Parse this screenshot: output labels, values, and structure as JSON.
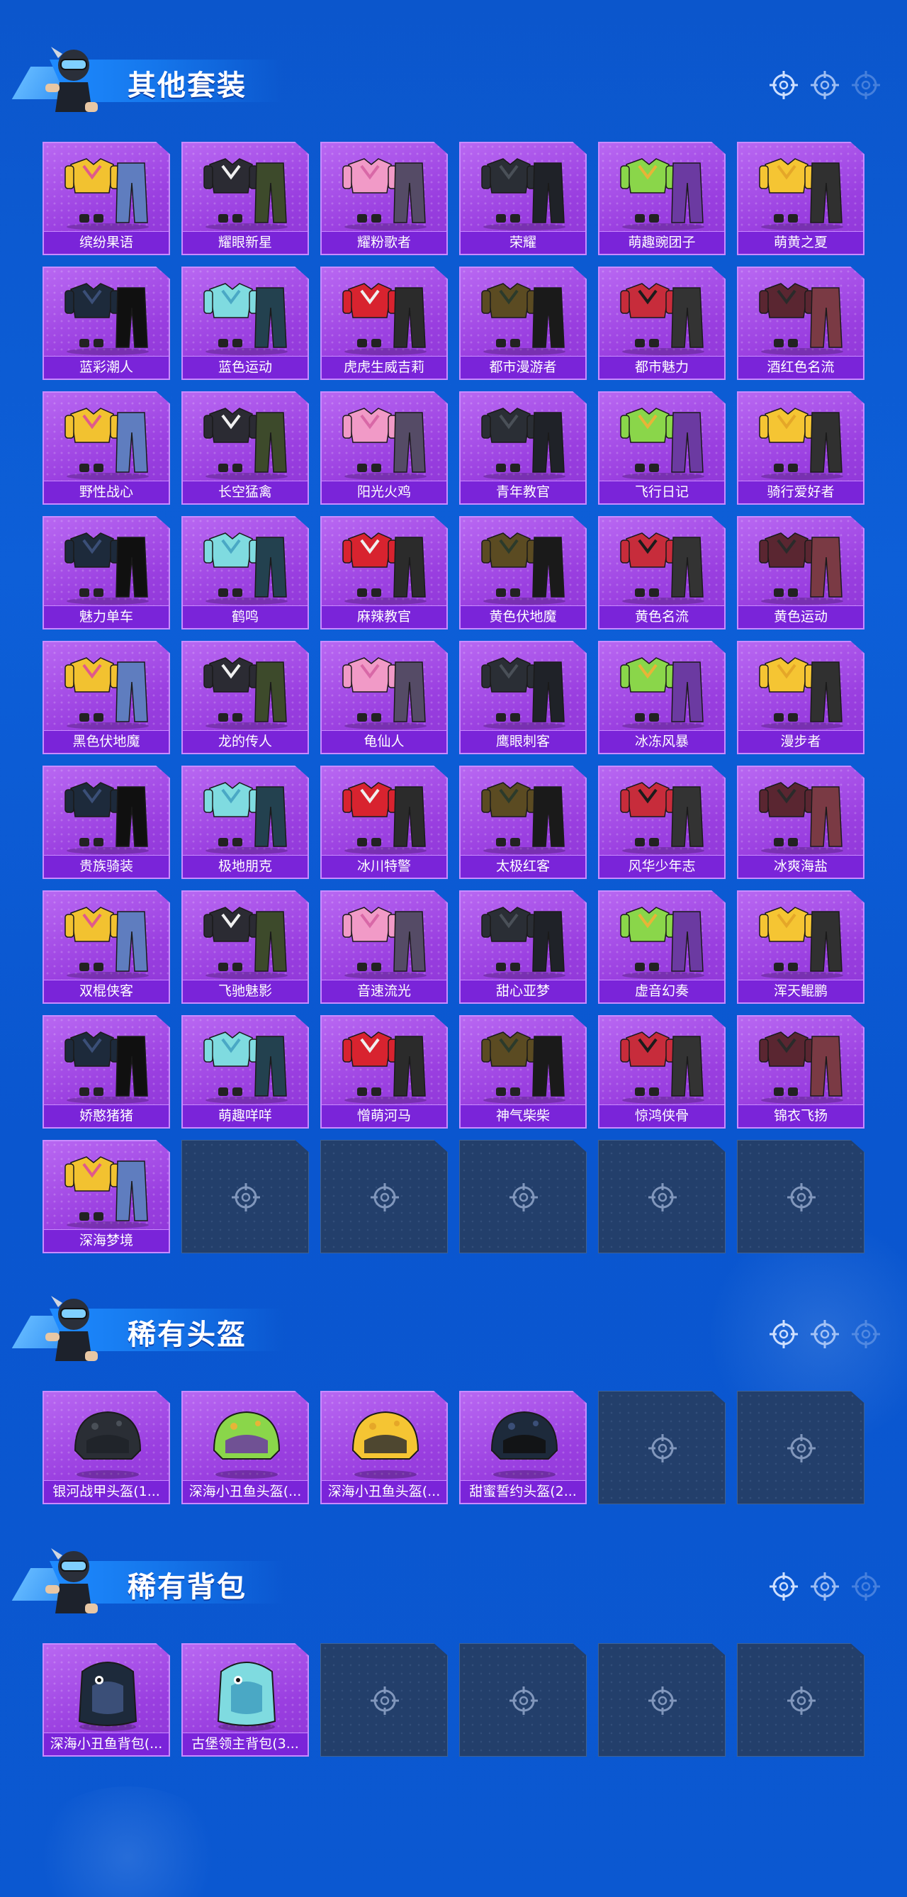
{
  "sections": [
    {
      "title": "其他套装",
      "items": [
        "缤纷果语",
        "耀眼新星",
        "耀粉歌者",
        "荣耀",
        "萌趣豌团子",
        "萌黄之夏",
        "蓝彩潮人",
        "蓝色运动",
        "虎虎生威吉莉",
        "都市漫游者",
        "都市魅力",
        "酒红色名流",
        "野性战心",
        "长空猛禽",
        "阳光火鸡",
        "青年教官",
        "飞行日记",
        "骑行爱好者",
        "魅力单车",
        "鹤鸣",
        "麻辣教官",
        "黄色伏地魔",
        "黄色名流",
        "黄色运动",
        "黑色伏地魔",
        "龙的传人",
        "龟仙人",
        "鹰眼刺客",
        "冰冻风暴",
        "漫步者",
        "贵族骑装",
        "极地朋克",
        "冰川特警",
        "太极红客",
        "风华少年志",
        "冰爽海盐",
        "双棍侠客",
        "飞驰魅影",
        "音速流光",
        "甜心亚梦",
        "虚音幻奏",
        "浑天鲲鹏",
        "娇憨猪猪",
        "萌趣咩咩",
        "憎萌河马",
        "神气柴柴",
        "惊鸿侠骨",
        "锦衣飞扬",
        "深海梦境"
      ],
      "empty_slots": 5
    },
    {
      "title": "稀有头盔",
      "items": [
        "银河战甲头盔(1...",
        "深海小丑鱼头盔(...",
        "深海小丑鱼头盔(...",
        "甜蜜誓约头盔(2..."
      ],
      "empty_slots": 2
    },
    {
      "title": "稀有背包",
      "items": [
        "深海小丑鱼背包(...",
        "古堡领主背包(3..."
      ],
      "empty_slots": 4
    }
  ],
  "icons": {
    "header_targets": "crosshair-icon",
    "empty_slot": "crosshair-icon",
    "mascot": "soldier-mascot"
  },
  "colors": {
    "background": "#0b56cc",
    "card": "#a94fe8",
    "card_label": "#7a24d9",
    "empty_card": "#22406e"
  }
}
